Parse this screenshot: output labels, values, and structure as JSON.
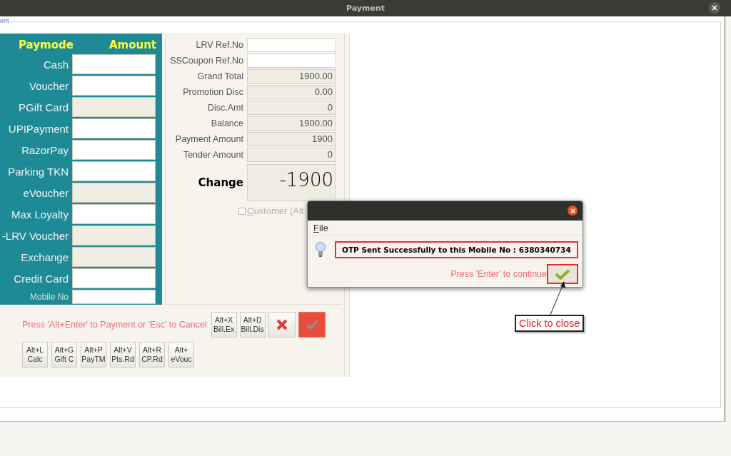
{
  "window": {
    "title": "Payment"
  },
  "frame_legend": "ent",
  "paymodes": {
    "headers": [
      "Paymode",
      "Amount"
    ],
    "rows": [
      {
        "label": "Cash",
        "kind": "normal",
        "disabled": false
      },
      {
        "label": "Voucher",
        "kind": "normal",
        "disabled": false
      },
      {
        "label": "PGift Card",
        "kind": "normal",
        "disabled": true
      },
      {
        "label": "UPIPayment",
        "kind": "normal",
        "disabled": false
      },
      {
        "label": "RazorPay",
        "kind": "normal",
        "disabled": false
      },
      {
        "label": "Parking TKN",
        "kind": "normal",
        "disabled": false
      },
      {
        "label": "eVoucher",
        "kind": "normal",
        "disabled": true
      },
      {
        "label": "Max Loyalty",
        "kind": "normal",
        "disabled": false
      },
      {
        "label": "-LRV Voucher",
        "kind": "normal",
        "disabled": true
      },
      {
        "label": "Exchange",
        "kind": "normal",
        "disabled": true
      },
      {
        "label": "Credit Card",
        "kind": "normal",
        "disabled": false
      },
      {
        "label": "Mobile No",
        "kind": "small",
        "disabled": false
      }
    ]
  },
  "summary": {
    "rows": [
      {
        "label": "LRV Ref.No",
        "kind": "input"
      },
      {
        "label": "SSCoupon Ref.No",
        "kind": "input"
      },
      {
        "label": "Grand Total",
        "kind": "readonly",
        "value": "1900.00"
      },
      {
        "label": "Promotion Disc",
        "kind": "readonly",
        "value": "0.00"
      },
      {
        "label": "Disc.Amt",
        "kind": "readonly",
        "value": "0"
      },
      {
        "label": "Balance",
        "kind": "readonly",
        "value": "1900.00"
      },
      {
        "label": "Payment Amount",
        "kind": "readonly",
        "value": "1900"
      },
      {
        "label": "Tender Amount",
        "kind": "readonly",
        "value": "0"
      }
    ],
    "change": {
      "label": "Change",
      "value": "-1900"
    },
    "customer_checkbox": {
      "label": "Customer (Alt",
      "checked": false
    }
  },
  "hint": "Press 'Alt+Enter' to Payment or 'Esc' to Cancel",
  "shortcut_buttons_row1": [
    {
      "key": "Alt+X",
      "label": "Bill.Ex"
    },
    {
      "key": "Alt+D",
      "label": "Bill.Dis"
    }
  ],
  "action_buttons": [
    {
      "kind": "cancel",
      "disabled": false
    },
    {
      "kind": "ok",
      "disabled": true
    }
  ],
  "shortcut_buttons_row2": [
    {
      "key": "Alt+L",
      "label": "Calc"
    },
    {
      "key": "Alt+G",
      "label": "Gift C"
    },
    {
      "key": "Alt+P",
      "label": "PayTM"
    },
    {
      "key": "Alt+V",
      "label": "Pts.Rd"
    },
    {
      "key": "Alt+R",
      "label": "CP.Rd"
    },
    {
      "key": "Alt+",
      "label": "eVouc"
    }
  ],
  "dialog": {
    "menu": [
      "File"
    ],
    "message": "OTP Sent Successfully to this Mobile No : 6380340734",
    "hint": "Press 'Enter' to continue"
  },
  "callout": {
    "text": "Click to close"
  }
}
